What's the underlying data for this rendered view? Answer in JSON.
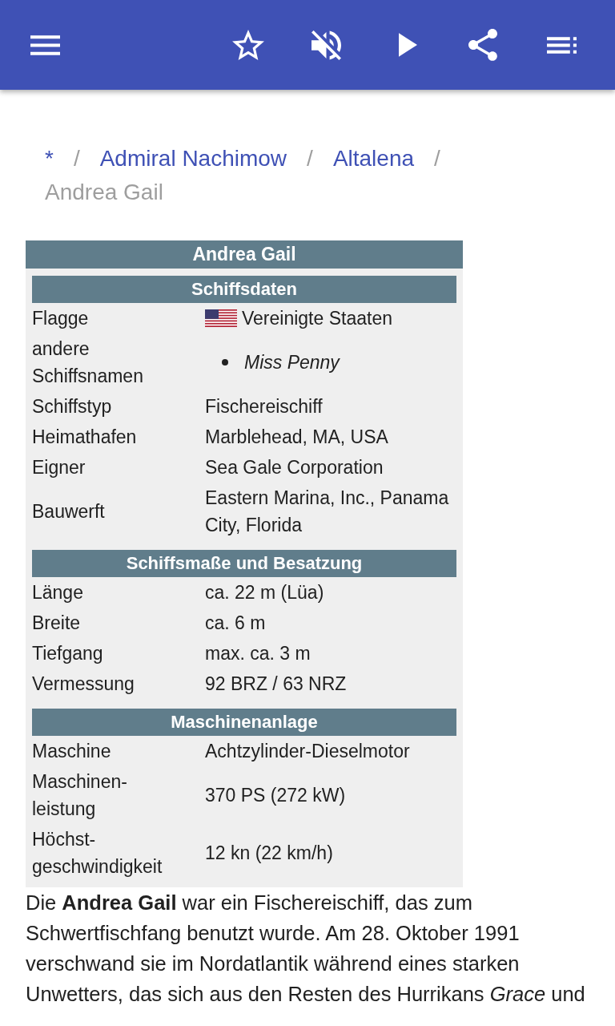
{
  "app_bar": {
    "starred": false,
    "muted": true
  },
  "breadcrumb": [
    {
      "label": "*",
      "current": false,
      "separator": "/"
    },
    {
      "label": "Admiral Nachimow",
      "current": false,
      "separator": "/"
    },
    {
      "label": "Altalena",
      "current": false,
      "separator": "/"
    },
    {
      "label": "Andrea Gail",
      "current": true
    }
  ],
  "infobox": {
    "title": "Andrea Gail",
    "sections": [
      {
        "title": "Schiffsdaten",
        "rows": [
          {
            "kind": "flag",
            "label": "Flagge",
            "value": "Vereinigte Staaten"
          },
          {
            "kind": "list",
            "label": "andere Schiffsnamen",
            "items": [
              "Miss Penny"
            ]
          },
          {
            "kind": "text",
            "label": "Schiffstyp",
            "value": "Fischereischiff"
          },
          {
            "kind": "text",
            "label": "Heimathafen",
            "value": "Marblehead, MA, USA"
          },
          {
            "kind": "text",
            "label": "Eigner",
            "value": "Sea Gale Corporation"
          },
          {
            "kind": "text",
            "label": "Bauwerft",
            "value": "Eastern Marina, Inc., Panama City, Florida"
          }
        ]
      },
      {
        "title": "Schiffsmaße und Besatzung",
        "rows": [
          {
            "kind": "text",
            "label": "Länge",
            "value": "ca. 22 m (Lüa)"
          },
          {
            "kind": "text",
            "label": "Breite",
            "value": "ca. 6 m"
          },
          {
            "kind": "text",
            "label": "Tiefgang",
            "value": "max. ca. 3 m"
          },
          {
            "kind": "text",
            "label": "Vermessung",
            "value": "92 BRZ / 63 NRZ"
          }
        ]
      },
      {
        "title": "Maschinenanlage",
        "rows": [
          {
            "kind": "text",
            "label": "Maschine",
            "value": "Achtzylinder-Dieselmotor"
          },
          {
            "kind": "text",
            "label": "Maschinen-leistung",
            "value": "370 PS (272 kW)"
          },
          {
            "kind": "text",
            "label": "Höchst-geschwindigkeit",
            "value": "12 kn (22 km/h)"
          }
        ]
      }
    ]
  },
  "paragraph": "Die **Andrea Gail** war ein Fischereischiff, das zum Schwertfischfang benutzt wurde. Am 28. Oktober 1991 verschwand sie im Nordatlantik während eines starken Unwetters, das sich aus den Resten des Hurrikans *Grace* und"
}
